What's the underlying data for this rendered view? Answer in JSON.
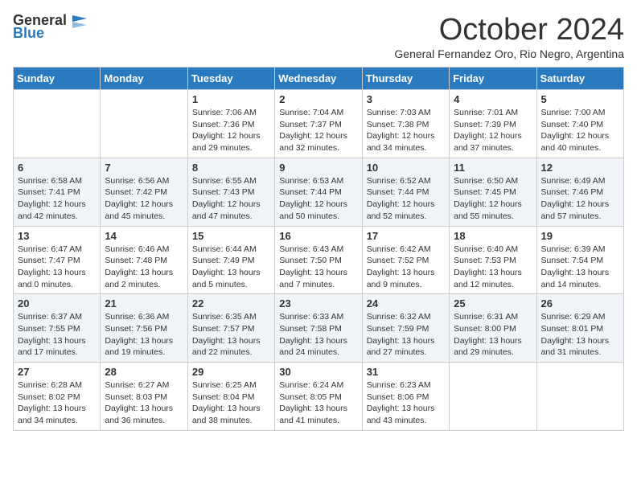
{
  "header": {
    "logo_general": "General",
    "logo_blue": "Blue",
    "month_title": "October 2024",
    "location": "General Fernandez Oro, Rio Negro, Argentina"
  },
  "days_of_week": [
    "Sunday",
    "Monday",
    "Tuesday",
    "Wednesday",
    "Thursday",
    "Friday",
    "Saturday"
  ],
  "weeks": [
    [
      {
        "num": "",
        "info": ""
      },
      {
        "num": "",
        "info": ""
      },
      {
        "num": "1",
        "info": "Sunrise: 7:06 AM\nSunset: 7:36 PM\nDaylight: 12 hours\nand 29 minutes."
      },
      {
        "num": "2",
        "info": "Sunrise: 7:04 AM\nSunset: 7:37 PM\nDaylight: 12 hours\nand 32 minutes."
      },
      {
        "num": "3",
        "info": "Sunrise: 7:03 AM\nSunset: 7:38 PM\nDaylight: 12 hours\nand 34 minutes."
      },
      {
        "num": "4",
        "info": "Sunrise: 7:01 AM\nSunset: 7:39 PM\nDaylight: 12 hours\nand 37 minutes."
      },
      {
        "num": "5",
        "info": "Sunrise: 7:00 AM\nSunset: 7:40 PM\nDaylight: 12 hours\nand 40 minutes."
      }
    ],
    [
      {
        "num": "6",
        "info": "Sunrise: 6:58 AM\nSunset: 7:41 PM\nDaylight: 12 hours\nand 42 minutes."
      },
      {
        "num": "7",
        "info": "Sunrise: 6:56 AM\nSunset: 7:42 PM\nDaylight: 12 hours\nand 45 minutes."
      },
      {
        "num": "8",
        "info": "Sunrise: 6:55 AM\nSunset: 7:43 PM\nDaylight: 12 hours\nand 47 minutes."
      },
      {
        "num": "9",
        "info": "Sunrise: 6:53 AM\nSunset: 7:44 PM\nDaylight: 12 hours\nand 50 minutes."
      },
      {
        "num": "10",
        "info": "Sunrise: 6:52 AM\nSunset: 7:44 PM\nDaylight: 12 hours\nand 52 minutes."
      },
      {
        "num": "11",
        "info": "Sunrise: 6:50 AM\nSunset: 7:45 PM\nDaylight: 12 hours\nand 55 minutes."
      },
      {
        "num": "12",
        "info": "Sunrise: 6:49 AM\nSunset: 7:46 PM\nDaylight: 12 hours\nand 57 minutes."
      }
    ],
    [
      {
        "num": "13",
        "info": "Sunrise: 6:47 AM\nSunset: 7:47 PM\nDaylight: 13 hours\nand 0 minutes."
      },
      {
        "num": "14",
        "info": "Sunrise: 6:46 AM\nSunset: 7:48 PM\nDaylight: 13 hours\nand 2 minutes."
      },
      {
        "num": "15",
        "info": "Sunrise: 6:44 AM\nSunset: 7:49 PM\nDaylight: 13 hours\nand 5 minutes."
      },
      {
        "num": "16",
        "info": "Sunrise: 6:43 AM\nSunset: 7:50 PM\nDaylight: 13 hours\nand 7 minutes."
      },
      {
        "num": "17",
        "info": "Sunrise: 6:42 AM\nSunset: 7:52 PM\nDaylight: 13 hours\nand 9 minutes."
      },
      {
        "num": "18",
        "info": "Sunrise: 6:40 AM\nSunset: 7:53 PM\nDaylight: 13 hours\nand 12 minutes."
      },
      {
        "num": "19",
        "info": "Sunrise: 6:39 AM\nSunset: 7:54 PM\nDaylight: 13 hours\nand 14 minutes."
      }
    ],
    [
      {
        "num": "20",
        "info": "Sunrise: 6:37 AM\nSunset: 7:55 PM\nDaylight: 13 hours\nand 17 minutes."
      },
      {
        "num": "21",
        "info": "Sunrise: 6:36 AM\nSunset: 7:56 PM\nDaylight: 13 hours\nand 19 minutes."
      },
      {
        "num": "22",
        "info": "Sunrise: 6:35 AM\nSunset: 7:57 PM\nDaylight: 13 hours\nand 22 minutes."
      },
      {
        "num": "23",
        "info": "Sunrise: 6:33 AM\nSunset: 7:58 PM\nDaylight: 13 hours\nand 24 minutes."
      },
      {
        "num": "24",
        "info": "Sunrise: 6:32 AM\nSunset: 7:59 PM\nDaylight: 13 hours\nand 27 minutes."
      },
      {
        "num": "25",
        "info": "Sunrise: 6:31 AM\nSunset: 8:00 PM\nDaylight: 13 hours\nand 29 minutes."
      },
      {
        "num": "26",
        "info": "Sunrise: 6:29 AM\nSunset: 8:01 PM\nDaylight: 13 hours\nand 31 minutes."
      }
    ],
    [
      {
        "num": "27",
        "info": "Sunrise: 6:28 AM\nSunset: 8:02 PM\nDaylight: 13 hours\nand 34 minutes."
      },
      {
        "num": "28",
        "info": "Sunrise: 6:27 AM\nSunset: 8:03 PM\nDaylight: 13 hours\nand 36 minutes."
      },
      {
        "num": "29",
        "info": "Sunrise: 6:25 AM\nSunset: 8:04 PM\nDaylight: 13 hours\nand 38 minutes."
      },
      {
        "num": "30",
        "info": "Sunrise: 6:24 AM\nSunset: 8:05 PM\nDaylight: 13 hours\nand 41 minutes."
      },
      {
        "num": "31",
        "info": "Sunrise: 6:23 AM\nSunset: 8:06 PM\nDaylight: 13 hours\nand 43 minutes."
      },
      {
        "num": "",
        "info": ""
      },
      {
        "num": "",
        "info": ""
      }
    ]
  ]
}
